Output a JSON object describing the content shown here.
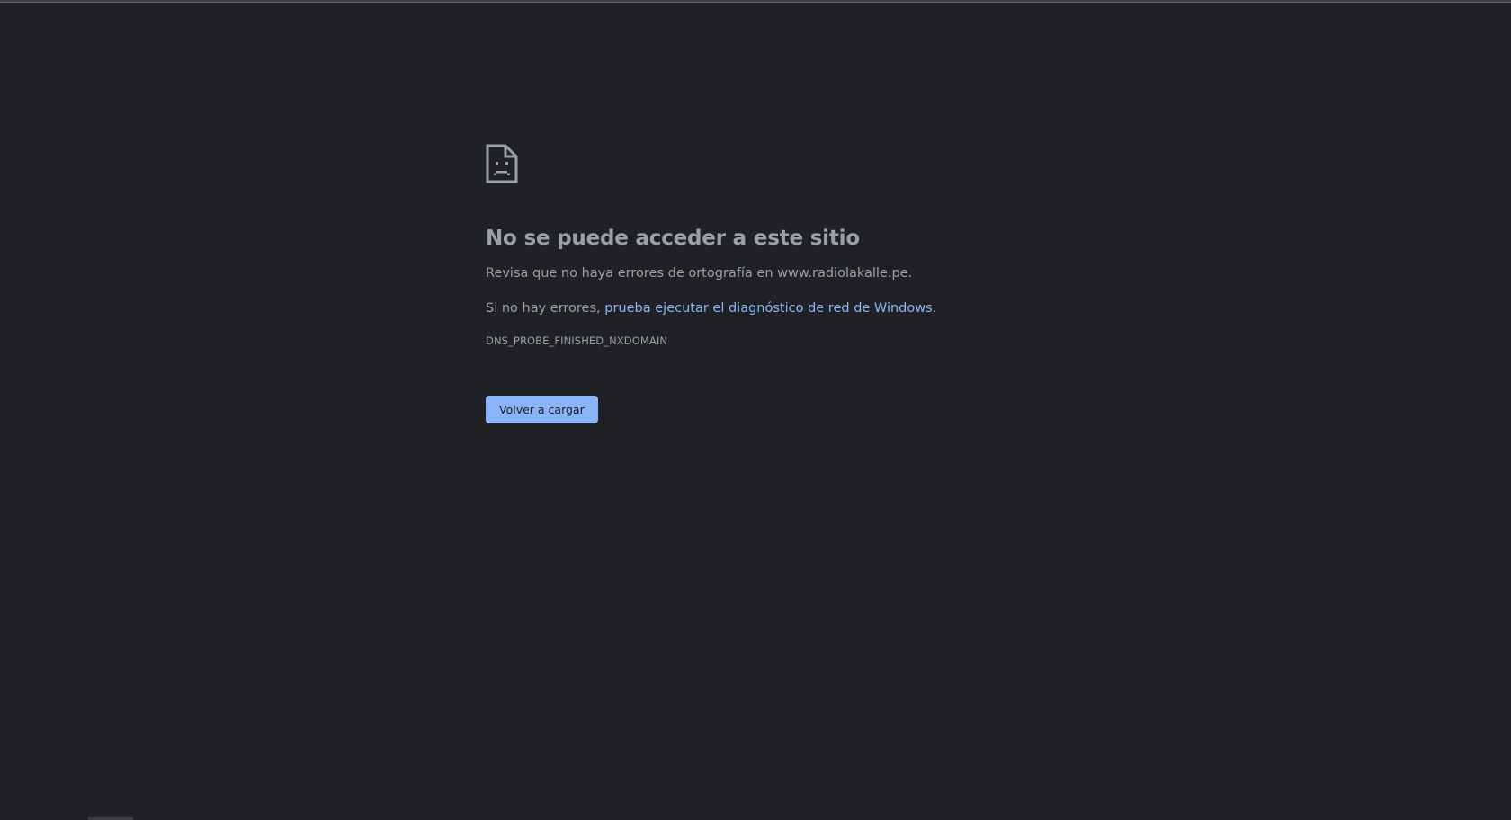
{
  "error": {
    "icon": "sad-page-icon",
    "title": "No se puede acceder a este sitio",
    "spelling_text": "Revisa que no haya errores de ortografía en www.radiolakalle.pe.",
    "suggestion_prefix": "Si no hay errores, ",
    "suggestion_link": "prueba ejecutar el diagnóstico de red de Windows",
    "suggestion_suffix": ".",
    "code": "DNS_PROBE_FINISHED_NXDOMAIN",
    "reload_label": "Volver a cargar"
  },
  "colors": {
    "background": "#202124",
    "text": "#9aa0a6",
    "link": "#8ab4f8",
    "button": "#8ab4f8"
  }
}
